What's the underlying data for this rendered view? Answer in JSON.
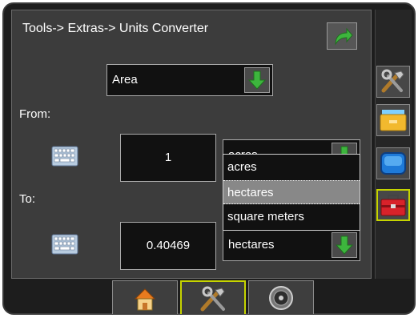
{
  "breadcrumb": "Tools-> Extras-> Units Converter",
  "category": {
    "value": "Area"
  },
  "from": {
    "label": "From:",
    "value": "1",
    "unit": "acres"
  },
  "to": {
    "label": "To:",
    "value": "0.40469",
    "unit": "hectares"
  },
  "unit_menu": {
    "options": [
      "acres",
      "hectares",
      "square meters"
    ],
    "selected": "hectares"
  },
  "colors": {
    "accent": "#c6d400",
    "arrow_green": "#3db53d",
    "panel": "#3c3c3c"
  },
  "icons": {
    "back": "return-arrow-icon",
    "sidebar": [
      "tools-icon",
      "folder-icon",
      "monitor-icon",
      "toolbox-icon"
    ],
    "bottom": [
      "home-icon",
      "tools-icon",
      "gauge-icon"
    ]
  }
}
